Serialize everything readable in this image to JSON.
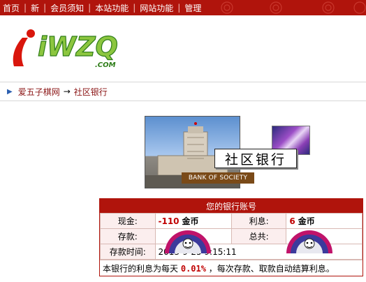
{
  "nav": {
    "items": [
      "首页",
      "新",
      "会员须知",
      "本站功能",
      "网站功能",
      "管理"
    ]
  },
  "logo": {
    "main": "iWZQ",
    "sub": ".COM"
  },
  "breadcrumb": {
    "home": "爱五子棋网",
    "arrow": "→",
    "current": "社区银行"
  },
  "bank": {
    "title": "社区银行",
    "caption": "BANK OF SOCIETY"
  },
  "account": {
    "header": "您的银行账号",
    "cash_label": "现金:",
    "cash_value": "-110",
    "cash_unit": "金币",
    "interest_label": "利息:",
    "interest_value": "6",
    "interest_unit": "金币",
    "deposit_label": "存款:",
    "deposit_value": "",
    "total_label": "总共:",
    "total_value": "",
    "time_label": "存款时间:",
    "time_value": "2013-9-25 9:15:11",
    "note_prefix": "本银行的利息为每天",
    "note_rate": "0.01%",
    "note_suffix": "，每次存款、取款自动结算利息。"
  },
  "colors": {
    "brand_red": "#b0140c",
    "value_red": "#c00000",
    "link": "#8a1313"
  }
}
